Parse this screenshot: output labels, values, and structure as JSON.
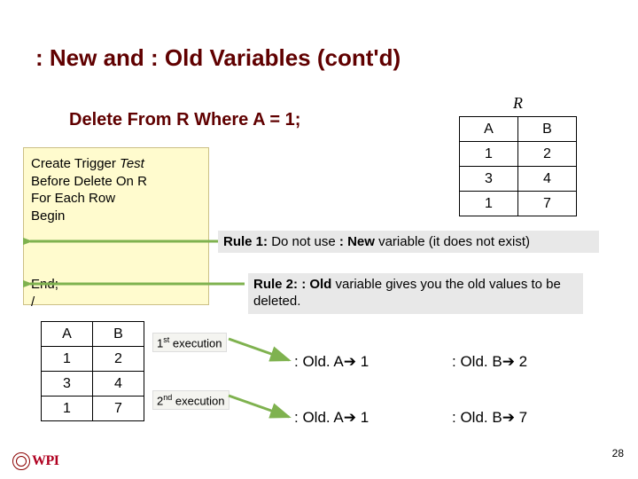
{
  "title": ": New and : Old Variables (cont'd)",
  "delete_stmt": "Delete From R Where A = 1;",
  "table_r": {
    "name": "R",
    "headers": [
      "A",
      "B"
    ],
    "rows": [
      [
        "1",
        "2"
      ],
      [
        "3",
        "4"
      ],
      [
        "1",
        "7"
      ]
    ]
  },
  "code": {
    "line1a": "Create Trigger ",
    "line1b": "Test",
    "line2": "Before Delete On R",
    "line3": "For Each Row",
    "line4": "Begin",
    "end1": "End;",
    "end2": "/"
  },
  "rule1": {
    "prefix": "Rule 1: ",
    "body_a": "Do not use ",
    "bold": ": New ",
    "body_b": "variable (it does not exist)"
  },
  "rule2": {
    "prefix": "Rule 2: ",
    "bold": ": Old ",
    "body": "variable gives you the old values to be deleted."
  },
  "table_small": {
    "headers": [
      "A",
      "B"
    ],
    "rows": [
      [
        "1",
        "2"
      ],
      [
        "3",
        "4"
      ],
      [
        "1",
        "7"
      ]
    ]
  },
  "exec": {
    "first": {
      "ord": "1",
      "suffix": "st",
      "word": " execution"
    },
    "second": {
      "ord": "2",
      "suffix": "nd",
      "word": " execution"
    }
  },
  "bindings": {
    "row1": {
      "a_label": ": Old. A",
      "a_arrow": "➔",
      "a_val": " 1",
      "b_label": ": Old. B",
      "b_arrow": "➔",
      "b_val": " 2"
    },
    "row2": {
      "a_label": ": Old. A",
      "a_arrow": "➔",
      "a_val": " 1",
      "b_label": ": Old. B",
      "b_arrow": "➔",
      "b_val": " 7"
    }
  },
  "pagenum": "28",
  "logo": "WPI"
}
